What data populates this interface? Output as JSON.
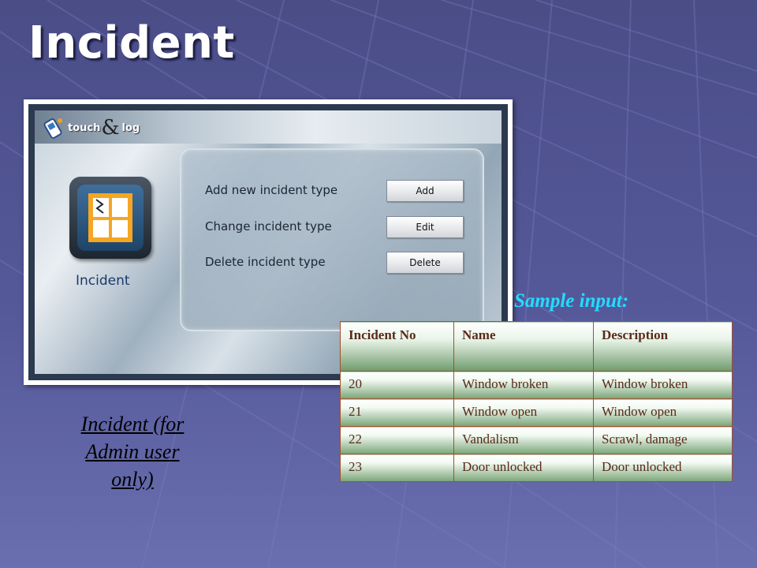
{
  "slide": {
    "title": "Incident"
  },
  "app": {
    "logo": {
      "text_left": "touch",
      "ampersand": "&",
      "text_right": "log"
    },
    "module": {
      "label": "Incident",
      "icon": "broken-window-icon"
    },
    "menu": [
      {
        "label": "Add new incident type",
        "button": "Add"
      },
      {
        "label": "Change incident type",
        "button": "Edit"
      },
      {
        "label": "Delete incident type",
        "button": "Delete"
      }
    ]
  },
  "caption": {
    "line1": "Incident (for",
    "line2": "Admin user",
    "line3": "only)"
  },
  "sample": {
    "label": "Sample input:",
    "headers": [
      "Incident No",
      "Name",
      "Description"
    ],
    "rows": [
      [
        "20",
        "Window broken",
        "Window broken"
      ],
      [
        "21",
        "Window open",
        "Window open"
      ],
      [
        "22",
        "Vandalism",
        "Scrawl,  damage"
      ],
      [
        "23",
        "Door unlocked",
        "Door unlocked"
      ]
    ]
  },
  "colors": {
    "background": "#55599a",
    "sample_label": "#23dcff",
    "table_border": "#a2502b",
    "table_text": "#5a2a18",
    "module_label": "#1a3a6b"
  }
}
